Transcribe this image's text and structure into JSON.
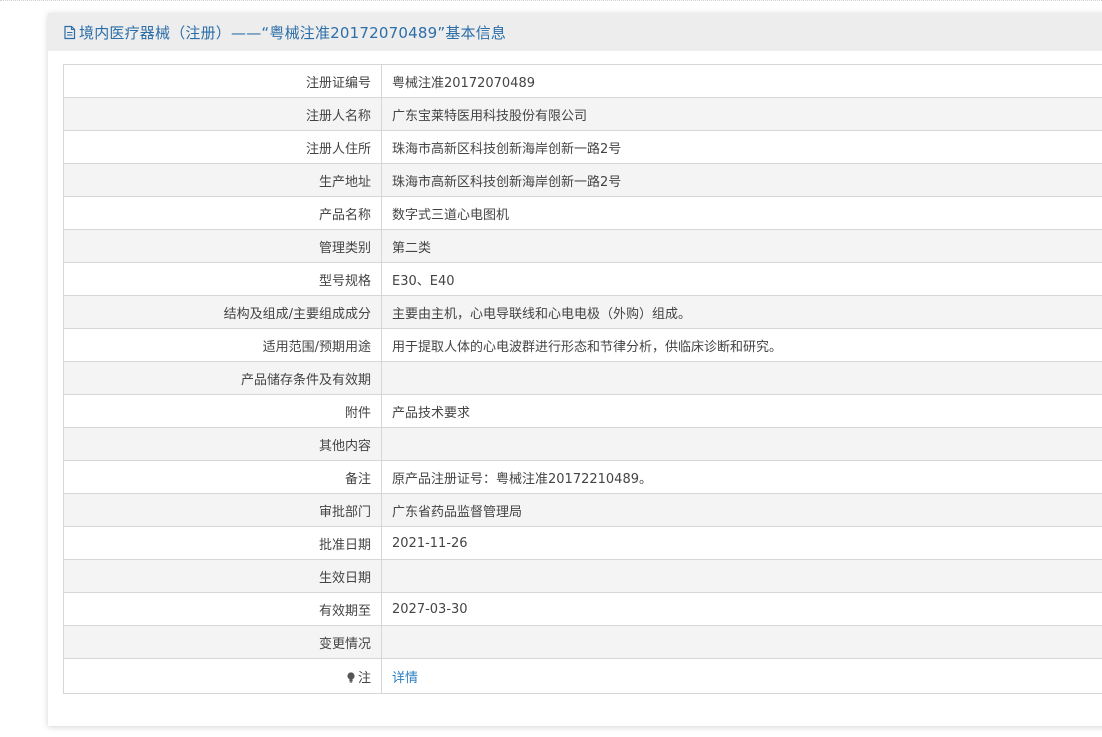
{
  "header": {
    "title": "境内医疗器械（注册）——“粤械注准20172070489”基本信息",
    "icon": "document-icon"
  },
  "rows": [
    {
      "label": "注册证编号",
      "value": "粤械注准20172070489"
    },
    {
      "label": "注册人名称",
      "value": "广东宝莱特医用科技股份有限公司"
    },
    {
      "label": "注册人住所",
      "value": "珠海市高新区科技创新海岸创新一路2号"
    },
    {
      "label": "生产地址",
      "value": "珠海市高新区科技创新海岸创新一路2号"
    },
    {
      "label": "产品名称",
      "value": "数字式三道心电图机"
    },
    {
      "label": "管理类别",
      "value": "第二类"
    },
    {
      "label": "型号规格",
      "value": "E30、E40"
    },
    {
      "label": "结构及组成/主要组成成分",
      "value": "主要由主机，心电导联线和心电电极（外购）组成。"
    },
    {
      "label": "适用范围/预期用途",
      "value": "用于提取人体的心电波群进行形态和节律分析，供临床诊断和研究。"
    },
    {
      "label": "产品储存条件及有效期",
      "value": ""
    },
    {
      "label": "附件",
      "value": "产品技术要求"
    },
    {
      "label": "其他内容",
      "value": ""
    },
    {
      "label": "备注",
      "value": "原产品注册证号：粤械注准20172210489。"
    },
    {
      "label": "审批部门",
      "value": "广东省药品监督管理局"
    },
    {
      "label": "批准日期",
      "value": "2021-11-26"
    },
    {
      "label": "生效日期",
      "value": ""
    },
    {
      "label": "有效期至",
      "value": "2027-03-30"
    },
    {
      "label": "变更情况",
      "value": ""
    }
  ],
  "note_row": {
    "label": "注",
    "icon": "lightbulb-icon",
    "link_text": "详情"
  },
  "colors": {
    "header_text": "#2b6ea8",
    "link": "#2b7fc1",
    "border": "#d6d6d6",
    "stripe": "#f4f4f4"
  }
}
